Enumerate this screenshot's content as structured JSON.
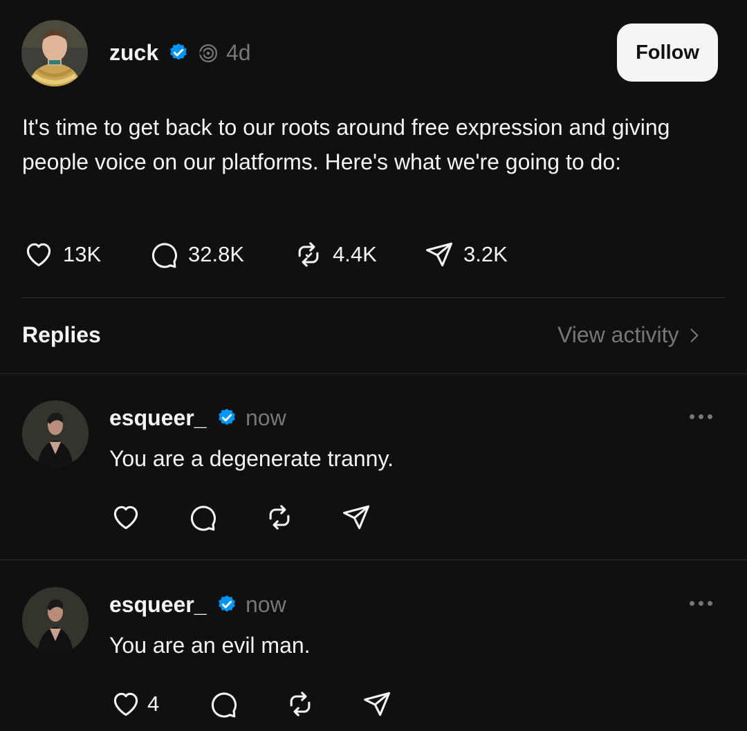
{
  "post": {
    "author": "zuck",
    "time": "4d",
    "follow_label": "Follow",
    "text": "It's time to get back to our roots around free expression and giving people voice on our platforms. Here's what we're going to do:",
    "stats": {
      "likes": "13K",
      "replies": "32.8K",
      "reposts": "4.4K",
      "shares": "3.2K"
    }
  },
  "replies_header": {
    "title": "Replies",
    "activity_link": "View activity"
  },
  "replies": [
    {
      "author": "esqueer_",
      "time": "now",
      "text": "You are a degenerate tranny.",
      "likes": ""
    },
    {
      "author": "esqueer_",
      "time": "now",
      "text": "You are an evil man.",
      "likes": "4"
    }
  ],
  "colors": {
    "background": "#101010",
    "text": "#f3f5f7",
    "muted": "#777777",
    "verified": "#0095f6",
    "divider": "#2e2e2e"
  }
}
